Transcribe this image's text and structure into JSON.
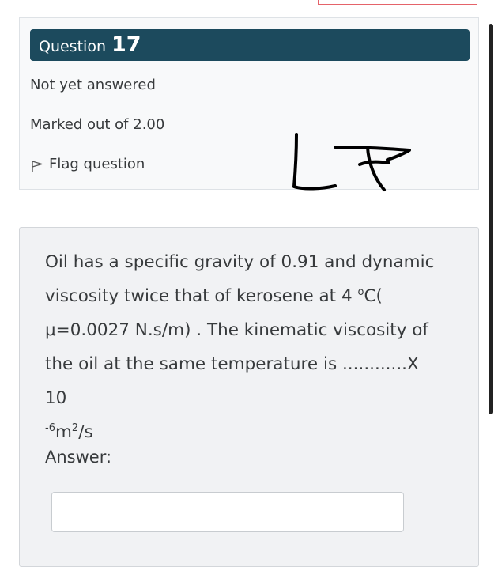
{
  "info": {
    "question_word": "Question",
    "question_number": "17",
    "state": "Not yet answered",
    "grade": "Marked out of 2.00",
    "flag_label": "Flag question",
    "flag_icon": "flag-outline-icon",
    "banner_color": "#1c4a5d"
  },
  "handwritten_note": "17",
  "question": {
    "line1": "Oil has a specific gravity of 0.91 and dynamic",
    "line2a": "viscosity twice that of kerosene at 4 ",
    "degree_symbol": "o",
    "line2b": "C(",
    "line3": "μ=0.0027 N.s/m)  . The kinematic viscosity of",
    "line4": "the oil at the same temperature is ............X 10",
    "exp_neg6": "-6",
    "unit_m": "m",
    "exp_2": "2",
    "unit_s": "/s",
    "answer_label": "Answer:",
    "answer_value": ""
  }
}
